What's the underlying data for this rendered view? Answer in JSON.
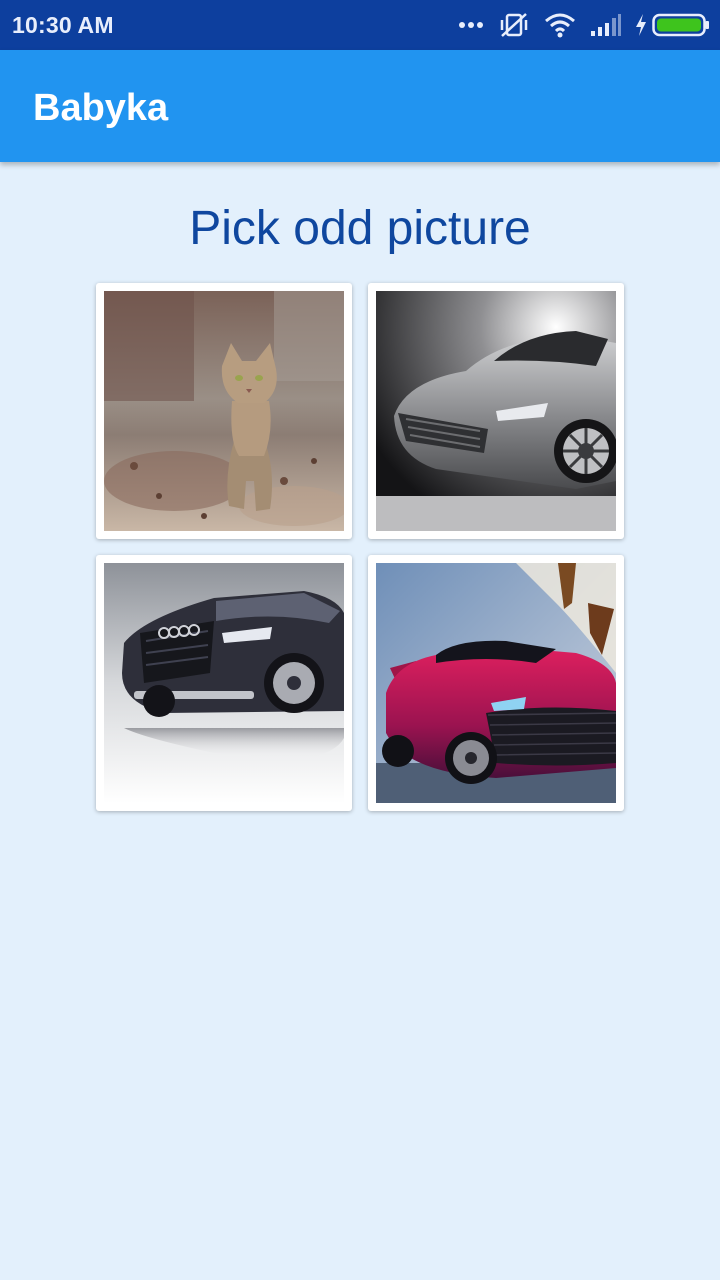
{
  "status_bar": {
    "time": "10:30 AM",
    "icons": [
      "more-dots-icon",
      "vibrate-off-icon",
      "wifi-icon",
      "signal-icon",
      "charging-icon",
      "battery-icon"
    ],
    "background": "#0d3f9e"
  },
  "app_bar": {
    "title": "Babyka",
    "background": "#2194f0"
  },
  "game": {
    "heading": "Pick odd picture",
    "heading_color": "#0f479f",
    "options": [
      {
        "subject": "cat",
        "name": "picture-cat"
      },
      {
        "subject": "silver sports car",
        "name": "picture-silver-car"
      },
      {
        "subject": "black suv",
        "name": "picture-black-suv"
      },
      {
        "subject": "red sports car",
        "name": "picture-red-car"
      }
    ]
  },
  "colors": {
    "page_background": "#e3f0fc",
    "card_background": "#ffffff"
  }
}
